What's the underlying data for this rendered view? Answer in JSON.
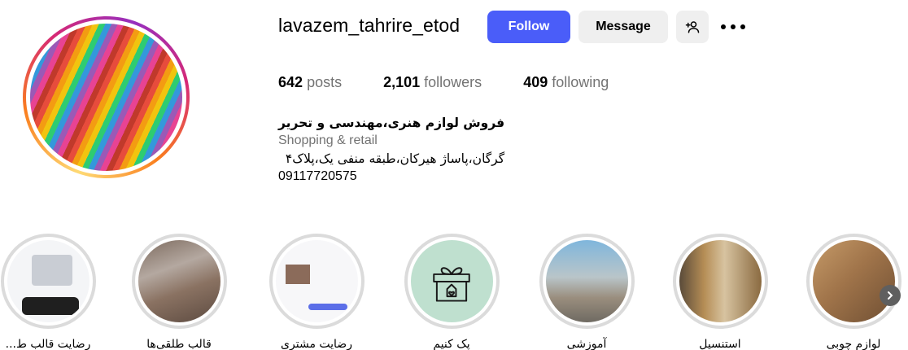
{
  "profile": {
    "username": "lavazem_tahrire_etod",
    "follow_label": "Follow",
    "message_label": "Message",
    "add_user_icon": "person-plus-icon",
    "more_icon": "more-horizontal-icon"
  },
  "stats": {
    "posts_count": "642",
    "posts_label": "posts",
    "followers_count": "2,101",
    "followers_label": "followers",
    "following_count": "409",
    "following_label": "following"
  },
  "bio": {
    "name": "فروش لوازم هنری،مهندسی و تحریر",
    "category": "Shopping & retail",
    "address": "گرگان،پاساژ هیرکان،طبقه منفی یک،پلاک۴",
    "phone": "09117720575"
  },
  "highlights": [
    {
      "label": "رضایت قالب ط..."
    },
    {
      "label": "قالب طلقی‌ها"
    },
    {
      "label": "رضایت مشتری"
    },
    {
      "label": "پک کنیم"
    },
    {
      "label": "آموزشی"
    },
    {
      "label": "استنسیل"
    },
    {
      "label": "لوازم چوبی"
    }
  ],
  "colors": {
    "follow_button": "#4a5df9",
    "secondary_button": "#efefef",
    "muted_text": "#737373"
  }
}
